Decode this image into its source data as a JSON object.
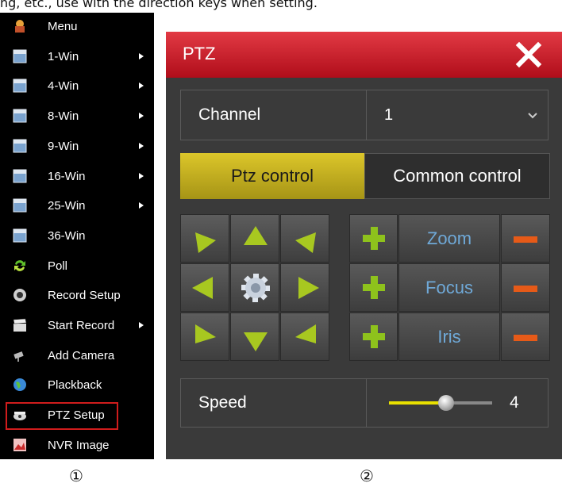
{
  "top_caption": "ng, etc., use with the direction keys when setting.",
  "menu": {
    "items": [
      {
        "label": "Menu",
        "icon": "home-icon",
        "submenu": false
      },
      {
        "label": "1-Win",
        "icon": "window-icon",
        "submenu": true
      },
      {
        "label": "4-Win",
        "icon": "window-icon",
        "submenu": true
      },
      {
        "label": "8-Win",
        "icon": "window-icon",
        "submenu": true
      },
      {
        "label": "9-Win",
        "icon": "window-icon",
        "submenu": true
      },
      {
        "label": "16-Win",
        "icon": "window-icon",
        "submenu": true
      },
      {
        "label": "25-Win",
        "icon": "window-icon",
        "submenu": true
      },
      {
        "label": "36-Win",
        "icon": "window-icon",
        "submenu": false
      },
      {
        "label": "Poll",
        "icon": "refresh-icon",
        "submenu": false
      },
      {
        "label": "Record Setup",
        "icon": "record-icon",
        "submenu": false
      },
      {
        "label": "Start Record",
        "icon": "clapperboard-icon",
        "submenu": true
      },
      {
        "label": "Add Camera",
        "icon": "camera-icon",
        "submenu": false
      },
      {
        "label": "Plackback",
        "icon": "globe-icon",
        "submenu": false
      },
      {
        "label": "PTZ Setup",
        "icon": "ptz-camera-icon",
        "submenu": false,
        "selected": true
      },
      {
        "label": "NVR Image",
        "icon": "image-icon",
        "submenu": false
      }
    ]
  },
  "ptz": {
    "title": "PTZ",
    "channel_label": "Channel",
    "channel_value": "1",
    "tabs": {
      "active": "Ptz control",
      "inactive": "Common control"
    },
    "controls": {
      "zoom": "Zoom",
      "focus": "Focus",
      "iris": "Iris"
    },
    "speed_label": "Speed",
    "speed_value": "4",
    "speed_level_fraction": 0.55
  },
  "captions": {
    "left": "①",
    "right": "②"
  },
  "colors": {
    "title_bar": "#c8202c",
    "active_tab": "#c8b420",
    "arrow_green": "#a8c820",
    "plus_green": "#8ec21c",
    "minus_orange": "#e65a18",
    "control_text": "#6fa9d8",
    "slider_yellow": "#e8e000"
  }
}
